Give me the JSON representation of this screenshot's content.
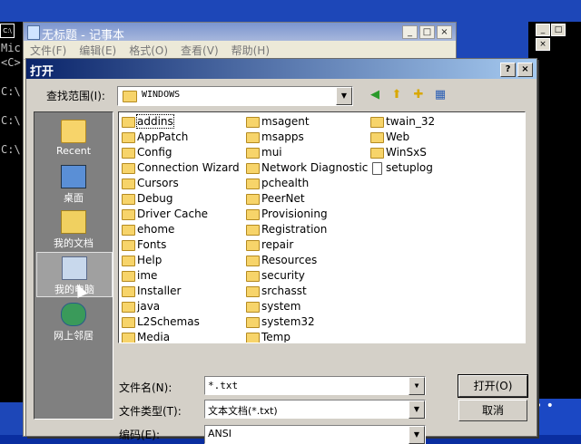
{
  "cmd": {
    "lines": [
      "Mic",
      "<C>",
      "C:\\",
      "C:\\",
      "C:\\"
    ]
  },
  "notepad": {
    "title": "无标题 - 记事本",
    "menu": [
      "文件(F)",
      "编辑(E)",
      "格式(O)",
      "查看(V)",
      "帮助(H)"
    ]
  },
  "dialog": {
    "title": "打开",
    "lookin_label": "查找范围(I):",
    "lookin_value": "WINDOWS",
    "places": [
      {
        "label": "Recent",
        "icon": "recent-icon"
      },
      {
        "label": "桌面",
        "icon": "desktop-icon"
      },
      {
        "label": "我的文档",
        "icon": "my-documents-icon"
      },
      {
        "label": "我的电脑",
        "icon": "my-computer-icon",
        "selected": true
      },
      {
        "label": "网上邻居",
        "icon": "network-places-icon"
      }
    ],
    "files": {
      "col1": [
        "addins",
        "AppPatch",
        "Config",
        "Connection Wizard",
        "Cursors",
        "Debug",
        "Driver Cache",
        "ehome",
        "Fonts",
        "Help",
        "ime",
        "Installer",
        "java",
        "L2Schemas",
        "Media"
      ],
      "col2": [
        "msagent",
        "msapps",
        "mui",
        "Network Diagnostic",
        "pchealth",
        "PeerNet",
        "Provisioning",
        "Registration",
        "repair",
        "Resources",
        "security",
        "srchasst",
        "system",
        "system32",
        "Temp"
      ],
      "col3": [
        "twain_32",
        "Web",
        "WinSxS",
        "setuplog"
      ]
    },
    "filename_label": "文件名(N):",
    "filename_value": "*.txt",
    "filetype_label": "文件类型(T):",
    "filetype_value": "文本文档(*.txt)",
    "encoding_label": "编码(E):",
    "encoding_value": "ANSI",
    "open_button": "打开(O)",
    "cancel_button": "取消"
  }
}
